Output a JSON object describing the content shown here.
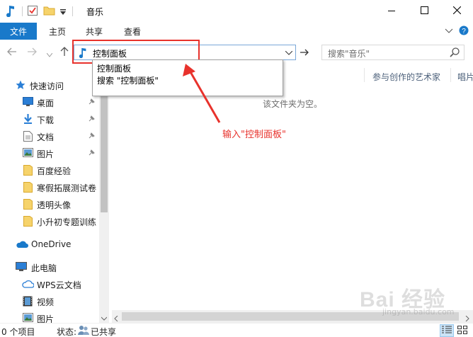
{
  "window": {
    "title": "音乐",
    "minimize_icon": "minimize-icon",
    "maximize_icon": "maximize-icon",
    "close_icon": "close-icon"
  },
  "ribbon": {
    "file": "文件",
    "tabs": [
      "主页",
      "共享",
      "查看"
    ]
  },
  "navigation": {
    "address_value": "控制面板",
    "search_placeholder": "搜索\"音乐\""
  },
  "suggestions": [
    "控制面板",
    "搜索 \"控制面板\""
  ],
  "sidebar": {
    "quick_access": "快速访问",
    "pinned": [
      {
        "label": "桌面",
        "icon": "desktop-icon"
      },
      {
        "label": "下载",
        "icon": "download-icon"
      },
      {
        "label": "文档",
        "icon": "document-icon"
      },
      {
        "label": "图片",
        "icon": "pictures-icon"
      }
    ],
    "folders": [
      "百度经验",
      "寒假拓展测试卷",
      "透明头像",
      "小升初专题训练"
    ],
    "onedrive": "OneDrive",
    "this_pc": "此电脑",
    "pc_items": [
      {
        "label": "WPS云文档",
        "icon": "cloud-icon"
      },
      {
        "label": "视频",
        "icon": "video-icon"
      },
      {
        "label": "图片",
        "icon": "pictures-icon"
      }
    ]
  },
  "content": {
    "columns": [
      "参与创作的艺术家",
      "唱片"
    ],
    "empty_message": "该文件夹为空。"
  },
  "annotation": "输入\"控制面板\"",
  "status": {
    "count": "0 个项目",
    "state_label": "状态:",
    "state_value": "已共享"
  },
  "watermark": {
    "main": "Bai 经验",
    "sub": "jingyan.baidu.com"
  },
  "colors": {
    "accent": "#1979ca",
    "highlight_red": "#e8322c"
  }
}
